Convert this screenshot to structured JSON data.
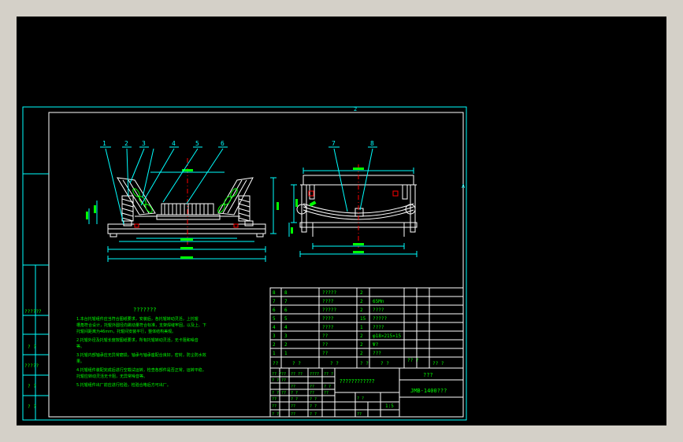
{
  "colors": {
    "background": "#000000",
    "frame": "#00ffff",
    "outline": "#ffffff",
    "parts": "#00ff00",
    "center": "#ff0000",
    "dimension": "#00ffff",
    "balloon": "#00ff00",
    "ui_bg": "#d4d0c8"
  },
  "callouts_left": [
    "1",
    "2",
    "3",
    "4",
    "5",
    "6"
  ],
  "callouts_right": [
    "7",
    "8"
  ],
  "zone_marks": {
    "top": "2",
    "right": "A"
  },
  "left_stamps": [
    "??????",
    "? ?",
    "?????",
    "? ?",
    "? ?"
  ],
  "tech_requirements": {
    "title": "???????",
    "lines": [
      "1.本台托辊组件应当符合图纸要求，安装后，各托辊转动灵活，上托辊",
      "  槽角符合设计，托辊外圆径向跳动量符合标准，支架焊缝牢固，以及上、下",
      "  托辊间距离为46mm，托辊间安装平行，整体结构美观。",
      "2.托辊外径及托辊长度按图纸要求，所有托辊转动灵活，无卡阻和噪音",
      "  等。",
      "3.托辊内部轴承应无异常磨损，轴承与轴承座配合良好，密封，防尘防水效",
      "  果。",
      "4.托辊组件装配完成后进行空载试运转，检查各部件是否正常，运转平稳，",
      "  托辊应转动灵活无卡阻，无异常噪音等。",
      "5.托辊组件出厂前应进行检验，检验合格后方可出厂。"
    ]
  },
  "parts_list": [
    {
      "no": "8",
      "code": "8",
      "name": "?????",
      "qty": "2",
      "material": ""
    },
    {
      "no": "7",
      "code": "7",
      "name": "????",
      "qty": "2",
      "material": "65Mn"
    },
    {
      "no": "6",
      "code": "6",
      "name": "?????",
      "qty": "2",
      "material": "????"
    },
    {
      "no": "5",
      "code": "5",
      "name": "????",
      "qty": "15",
      "material": "?????"
    },
    {
      "no": "4",
      "code": "4",
      "name": "????",
      "qty": "1",
      "material": "????"
    },
    {
      "no": "3",
      "code": "3",
      "name": "??",
      "qty": "2",
      "material": "φ18×215×15"
    },
    {
      "no": "2",
      "code": "2",
      "name": "??",
      "qty": "2",
      "material": "Ψ?"
    },
    {
      "no": "1",
      "code": "1",
      "name": "??",
      "qty": "2",
      "material": "???"
    }
  ],
  "parts_header": [
    "??",
    "? ?",
    "? ?",
    "? ?",
    "? ?"
  ],
  "parts_header_extra": [
    "?? ?",
    "?? ?"
  ],
  "title_block": {
    "company": "???",
    "drawing_title": "????????????",
    "drawing_no": "JMB-1400???",
    "scale_value": "1:5",
    "stamps": [
      "?? ?",
      "??",
      "?? ??",
      "????",
      "?? ?",
      "? ?",
      "??",
      "??",
      "??",
      "? ?",
      "? ?",
      "??",
      "? ?",
      "??",
      "??",
      "??",
      "? ?",
      "? ?",
      "??",
      "??",
      "? ?",
      "? ?",
      "??",
      "? ?",
      "? ?",
      "??"
    ]
  }
}
